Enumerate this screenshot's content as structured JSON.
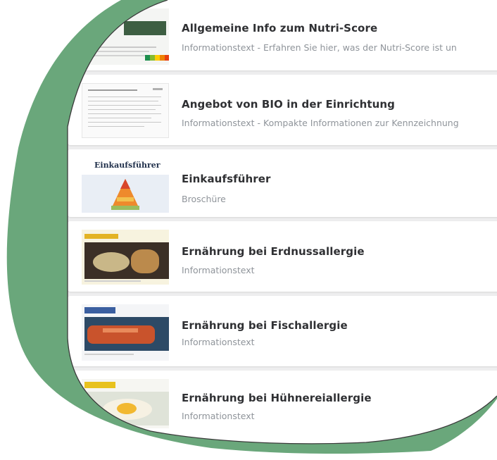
{
  "items": [
    {
      "title": "Allgemeine Info zum Nutri-Score",
      "subtitle": "Informationstext - Erfahren Sie hier, was der Nutri-Score ist un",
      "thumbnail": "nutri-score-document"
    },
    {
      "title": "Angebot von BIO in der Einrichtung",
      "subtitle": "Informationstext - Kompakte Informationen zur Kennzeichnung",
      "thumbnail": "text-document"
    },
    {
      "title": "Einkaufsführer",
      "subtitle": "Broschüre",
      "thumbnail": "food-pyramid-brochure",
      "thumb_text": "Einkaufsführer"
    },
    {
      "title": "Ernährung bei Erdnussallergie",
      "subtitle": "Informationstext",
      "thumbnail": "peanut-photo"
    },
    {
      "title": "Ernährung bei Fischallergie",
      "subtitle": "Informationstext",
      "thumbnail": "fish-photo"
    },
    {
      "title": "Ernährung bei Hühnereiallergie",
      "subtitle": "Informationstext",
      "thumbnail": "egg-photo"
    }
  ],
  "colors": {
    "frame_fill": "#ffffff",
    "frame_outline": "#3a3a3a",
    "shadow_green": "#6aa77b",
    "background": "#eeeeef"
  }
}
